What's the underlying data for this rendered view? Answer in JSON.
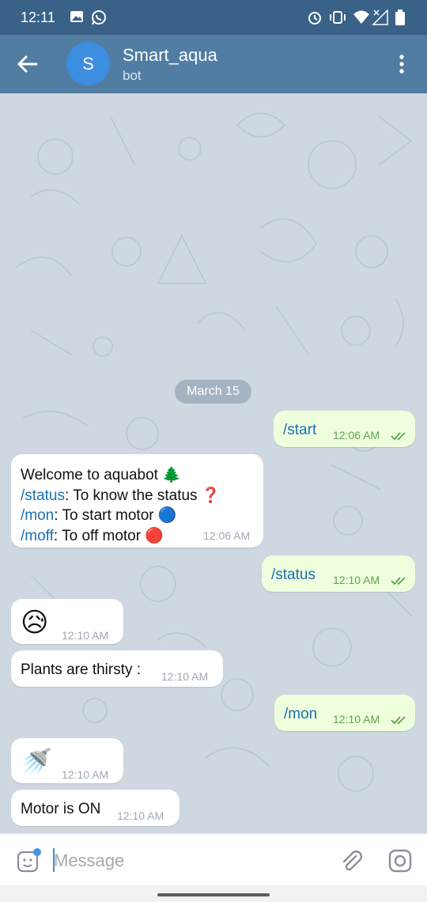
{
  "status_bar": {
    "time": "12:11"
  },
  "header": {
    "avatar_letter": "S",
    "title": "Smart_aqua",
    "subtitle": "bot"
  },
  "date_separator": "March 15",
  "messages": [
    {
      "dir": "out",
      "text": "/start",
      "time": "12:06 AM"
    },
    {
      "dir": "in",
      "lines": [
        {
          "pre": "Welcome to aquabot",
          "cmd": "",
          "rest": "",
          "emoji": "🌲"
        },
        {
          "pre": "",
          "cmd": "/status",
          "rest": ": To know the status",
          "emoji": "❓"
        },
        {
          "pre": "",
          "cmd": "/mon",
          "rest": ": To start motor",
          "emoji": "🔵"
        },
        {
          "pre": "",
          "cmd": "/moff",
          "rest": ": To off motor",
          "emoji": "🔴"
        }
      ],
      "time": "12:06 AM"
    },
    {
      "dir": "out",
      "text": "/status",
      "time": "12:10 AM"
    },
    {
      "dir": "in",
      "emoji": "😥",
      "time": "12:10 AM"
    },
    {
      "dir": "in",
      "text": "Plants are thirsty :",
      "time": "12:10 AM"
    },
    {
      "dir": "out",
      "text": "/mon",
      "time": "12:10 AM"
    },
    {
      "dir": "in",
      "emoji": "🚿",
      "time": "12:10 AM"
    },
    {
      "dir": "in",
      "text": "Motor is ON",
      "time": "12:10 AM"
    }
  ],
  "composer": {
    "placeholder": "Message"
  },
  "colors": {
    "header": "#517da2",
    "statusbar": "#3a6187",
    "outgoing_bubble": "#effedd",
    "command_link": "#1a6fb3",
    "read_check": "#5ea44d"
  }
}
